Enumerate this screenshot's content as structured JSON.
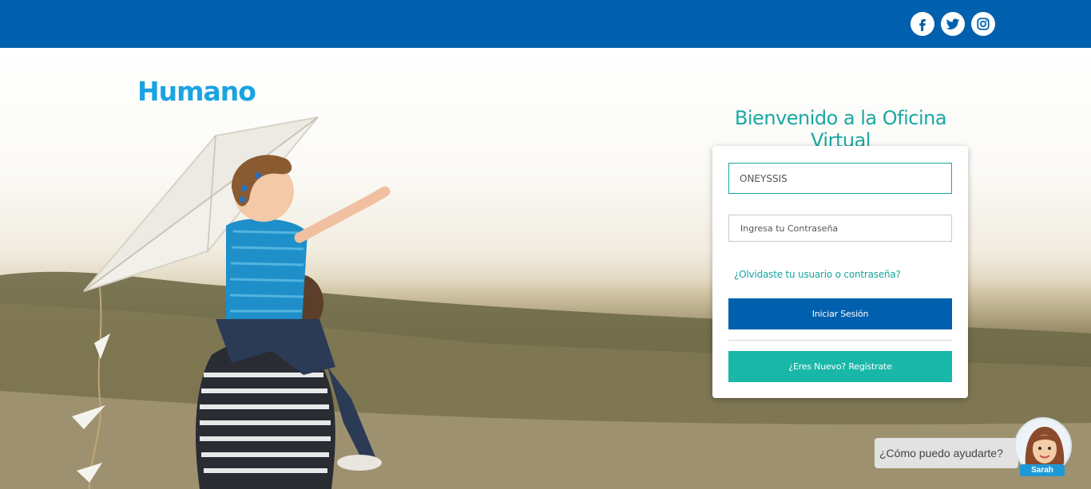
{
  "header": {
    "social": [
      {
        "name": "facebook-icon"
      },
      {
        "name": "twitter-icon"
      },
      {
        "name": "instagram-icon"
      }
    ]
  },
  "brand": {
    "logo_text": "Humano"
  },
  "login": {
    "title": "Bienvenido a la Oficina Virtual",
    "username_value": "ONEYSSIS",
    "password_placeholder": "Ingresa tu Contraseña",
    "forgot_link": "¿Olvidaste tu usuario o contraseña?",
    "login_button": "Iniciar Sesión",
    "register_button": "¿Eres Nuevo? Regístrate"
  },
  "chat": {
    "prompt": "¿Cómo puedo ayudarte?",
    "assistant_name": "Sarah"
  },
  "colors": {
    "primary_blue": "#0060ad",
    "teal": "#17a6a0",
    "logo_blue": "#1aa3e2"
  }
}
